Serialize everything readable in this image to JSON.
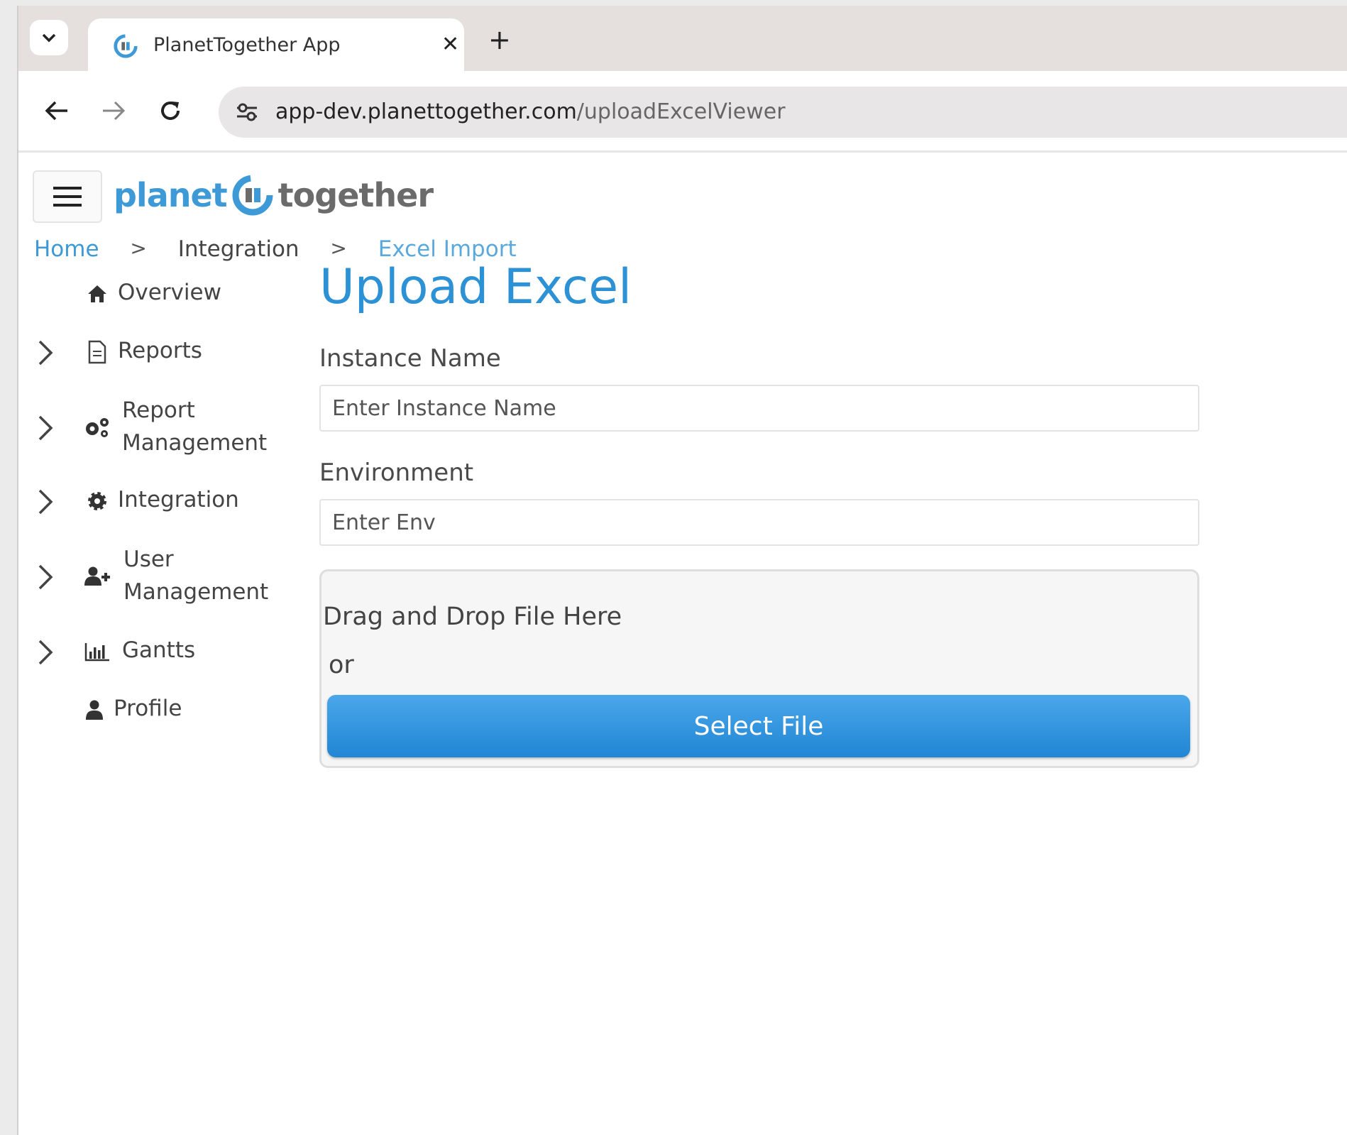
{
  "browser": {
    "tab_title": "PlanetTogether App",
    "tab_close": "✕",
    "new_tab": "+",
    "url_host": "app-dev.planettogether.com",
    "url_path": "/uploadExcelViewer"
  },
  "header": {
    "logo_left": "planet",
    "logo_right": "together"
  },
  "breadcrumb": {
    "items": [
      "Home",
      "Integration",
      "Excel Import"
    ],
    "separator": ">"
  },
  "sidebar": {
    "items": [
      {
        "label": "Overview",
        "icon": "home-icon",
        "expandable": false
      },
      {
        "label": "Reports",
        "icon": "document-icon",
        "expandable": true
      },
      {
        "label_line1": "Report",
        "label_line2": "Management",
        "icon": "cogs-icon",
        "expandable": true
      },
      {
        "label": "Integration",
        "icon": "gear-icon",
        "expandable": true
      },
      {
        "label_line1": "User",
        "label_line2": "Management",
        "icon": "user-add-icon",
        "expandable": true
      },
      {
        "label": "Gantts",
        "icon": "bar-chart-icon",
        "expandable": true
      },
      {
        "label": "Profile",
        "icon": "user-icon",
        "expandable": false
      }
    ]
  },
  "main": {
    "title": "Upload Excel",
    "instance_label": "Instance Name",
    "instance_placeholder": "Enter Instance Name",
    "instance_value": "",
    "env_label": "Environment",
    "env_placeholder": "Enter Env",
    "env_value": "",
    "drop_text": "Drag and Drop File Here",
    "or_text": "or",
    "select_button": "Select File"
  },
  "colors": {
    "accent": "#2c91d5",
    "button": "#2a8ad6",
    "link": "#3e9ad6"
  }
}
